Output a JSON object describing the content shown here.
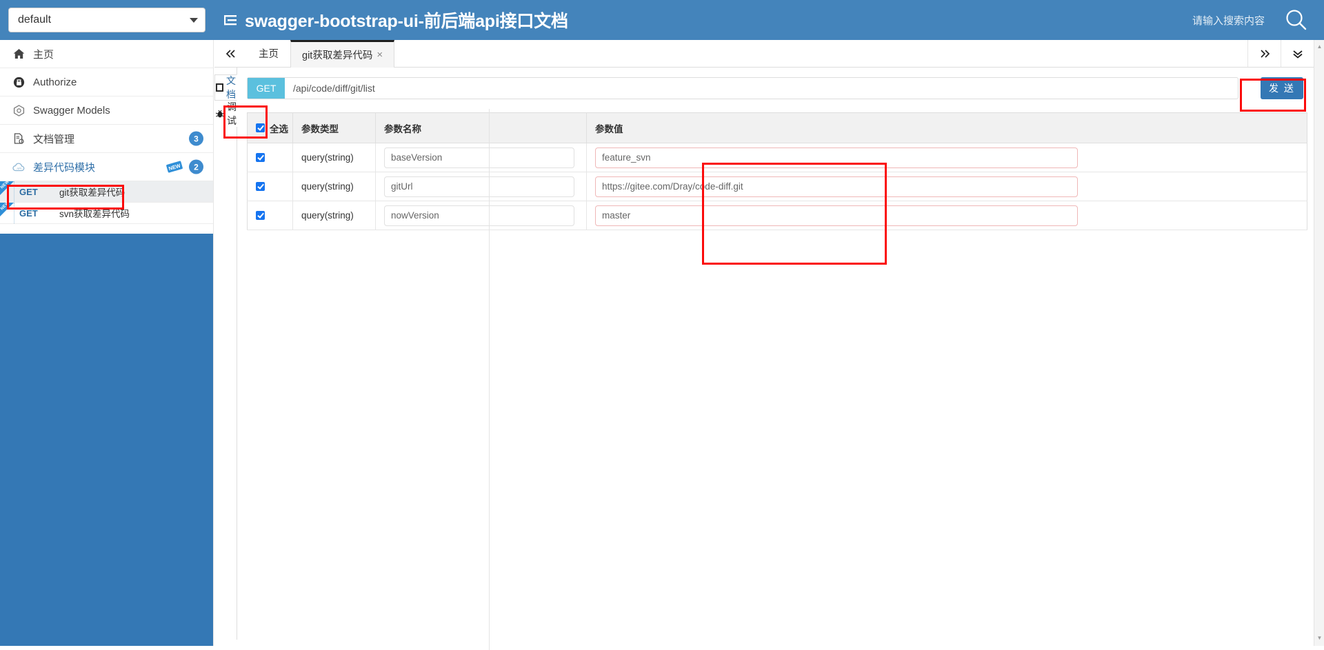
{
  "header": {
    "select_value": "default",
    "select_options": [
      "default"
    ],
    "title": "swagger-bootstrap-ui-前后端api接口文档",
    "menu_icon": "hamburger-icon",
    "search_placeholder": "请输入搜索内容",
    "search_icon": "search-icon",
    "brand_color": "#4484bb"
  },
  "sidebar": {
    "items": [
      {
        "label": "主页",
        "icon": "home-icon",
        "badge": ""
      },
      {
        "label": "Authorize",
        "icon": "lock-icon",
        "badge": ""
      },
      {
        "label": "Swagger Models",
        "icon": "models-icon",
        "badge": ""
      },
      {
        "label": "文档管理",
        "icon": "document-settings-icon",
        "badge": "3"
      },
      {
        "label": "差异代码模块",
        "icon": "cloud-api-icon",
        "badge": "2",
        "new_tag": "NEW"
      }
    ],
    "endpoints": [
      {
        "method": "GET",
        "name": "git获取差异代码",
        "new_tag": "NEW",
        "active": true
      },
      {
        "method": "GET",
        "name": "svn获取差异代码",
        "new_tag": "NEW",
        "active": false
      }
    ],
    "fill_color": "#3478b5"
  },
  "tabbar": {
    "collapse_icon": "chevron-double-left-icon",
    "tabs": [
      {
        "label": "主页",
        "closable": false,
        "active": false
      },
      {
        "label": "git获取差异代码",
        "closable": true,
        "close_glyph": "×",
        "active": true
      }
    ],
    "right_buttons": [
      {
        "icon": "chevron-double-right-icon"
      },
      {
        "icon": "chevron-double-down-icon"
      }
    ]
  },
  "vtabs": [
    {
      "label": "文档",
      "icon": "document-icon",
      "active": false
    },
    {
      "label": "调试",
      "icon": "bug-icon",
      "active": true
    }
  ],
  "request": {
    "method": "GET",
    "method_color": "#5bc0de",
    "path": "/api/code/diff/git/list",
    "send_label": "发 送",
    "send_color": "#3478b5"
  },
  "params_table": {
    "columns": [
      "全选",
      "参数类型",
      "参数名称",
      "参数值"
    ],
    "select_all_checked": true,
    "rows": [
      {
        "checked": true,
        "type": "query(string)",
        "name": "baseVersion",
        "value": "feature_svn"
      },
      {
        "checked": true,
        "type": "query(string)",
        "name": "gitUrl",
        "value": "https://gitee.com/Dray/code-diff.git"
      },
      {
        "checked": true,
        "type": "query(string)",
        "name": "nowVersion",
        "value": "master"
      }
    ]
  },
  "annotations": {
    "highlight_color": "#fb0b0b",
    "boxes": [
      "sidebar-active-endpoint",
      "debug-vtab",
      "send-button",
      "param-value-column"
    ]
  }
}
